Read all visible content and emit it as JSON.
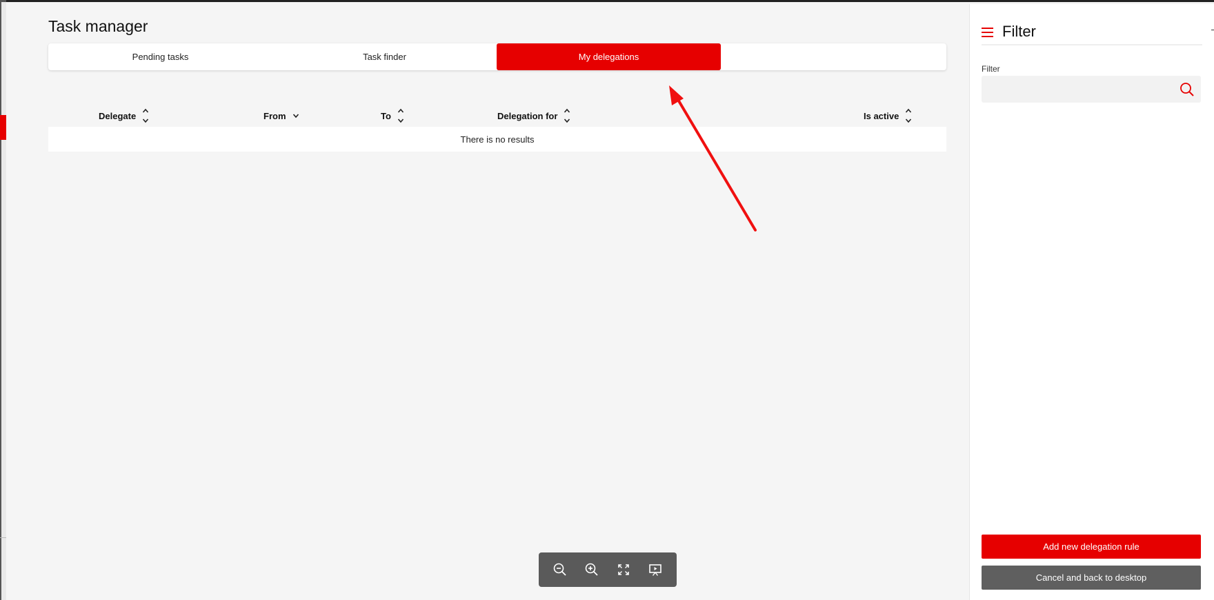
{
  "page": {
    "title": "Task manager"
  },
  "tabs": [
    {
      "label": "Pending tasks",
      "active": false
    },
    {
      "label": "Task finder",
      "active": false
    },
    {
      "label": "My delegations",
      "active": true
    }
  ],
  "table": {
    "columns": [
      {
        "label": "Delegate",
        "sort": "both"
      },
      {
        "label": "From",
        "sort": "down"
      },
      {
        "label": "To",
        "sort": "both"
      },
      {
        "label": "Delegation for",
        "sort": "both"
      },
      {
        "label": "Is active",
        "sort": "both"
      }
    ],
    "empty_message": "There is no results"
  },
  "toolbar": {
    "buttons": [
      "zoom-out-icon",
      "zoom-in-icon",
      "fullscreen-icon",
      "presentation-icon"
    ]
  },
  "panel": {
    "title": "Filter",
    "filter_label": "Filter",
    "filter_value": "",
    "filter_placeholder": "",
    "add_button_label": "Add new delegation rule",
    "cancel_button_label": "Cancel and back to desktop"
  },
  "colors": {
    "accent": "#e60000",
    "background": "#f5f5f5",
    "panel": "#ffffff",
    "toolbar": "#5a5a5a",
    "secondary_button": "#5f5f5f"
  }
}
